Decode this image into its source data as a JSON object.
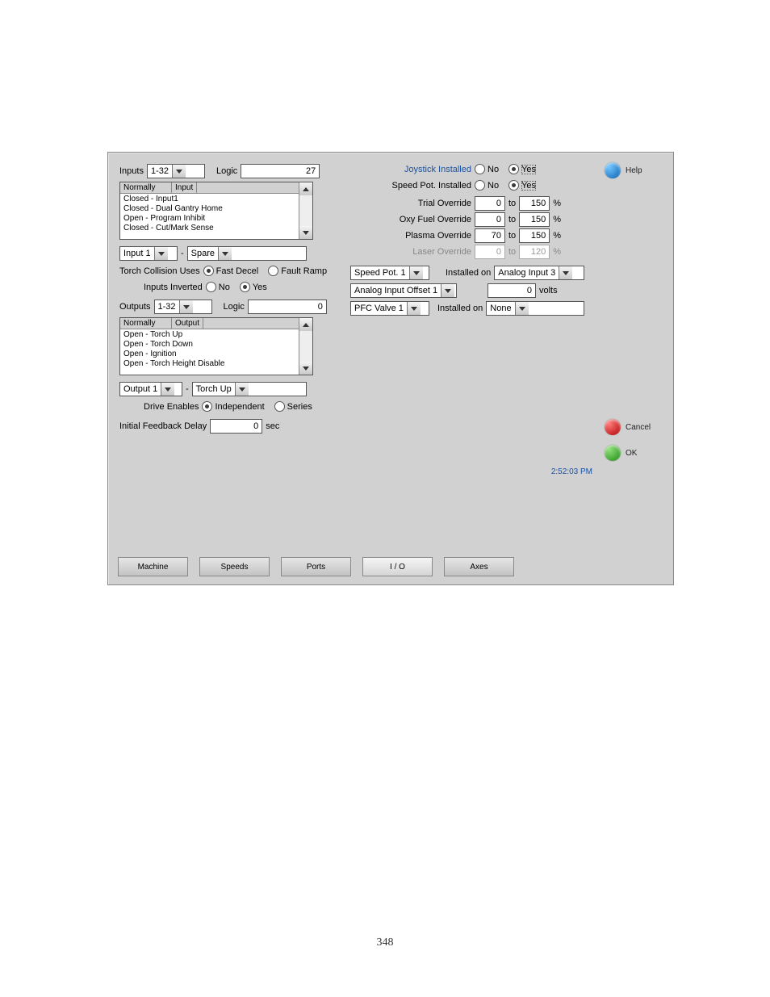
{
  "page_number": "348",
  "time": "2:52:03 PM",
  "inputs": {
    "label": "Inputs",
    "range": "1-32",
    "logic_label": "Logic",
    "logic_value": "27",
    "list_header": {
      "col1": "Normally",
      "col2": "Input"
    },
    "rows": [
      "Closed  -  Input1",
      "Closed  -  Dual Gantry Home",
      "Open    -  Program Inhibit",
      "Closed  -  Cut/Mark Sense"
    ],
    "assign_left": "Input 1",
    "assign_right": "Spare"
  },
  "torch_collision": {
    "label": "Torch Collision Uses",
    "opt1": "Fast Decel",
    "opt2": "Fault Ramp",
    "selected": "opt1"
  },
  "inputs_inverted": {
    "label": "Inputs Inverted",
    "no": "No",
    "yes": "Yes",
    "selected": "yes"
  },
  "outputs": {
    "label": "Outputs",
    "range": "1-32",
    "logic_label": "Logic",
    "logic_value": "0",
    "list_header": {
      "col1": "Normally",
      "col2": "Output"
    },
    "rows": [
      "Open    -  Torch Up",
      "Open    -  Torch Down",
      "Open    -  Ignition",
      "Open    -  Torch Height Disable"
    ],
    "assign_left": "Output 1",
    "assign_right": "Torch Up"
  },
  "drive_enables": {
    "label": "Drive Enables",
    "opt1": "Independent",
    "opt2": "Series",
    "selected": "opt1"
  },
  "feedback_delay": {
    "label": "Initial Feedback Delay",
    "value": "0",
    "unit": "sec"
  },
  "joystick": {
    "label": "Joystick Installed",
    "no": "No",
    "yes": "Yes",
    "selected": "yes"
  },
  "speedpot": {
    "label": "Speed Pot. Installed",
    "no": "No",
    "yes": "Yes",
    "selected": "yes"
  },
  "overrides": {
    "to": "to",
    "pct": "%",
    "trial": {
      "label": "Trial Override",
      "lo": "0",
      "hi": "150",
      "enabled": true
    },
    "oxy": {
      "label": "Oxy Fuel Override",
      "lo": "0",
      "hi": "150",
      "enabled": true
    },
    "plasma": {
      "label": "Plasma Override",
      "lo": "70",
      "hi": "150",
      "enabled": true
    },
    "laser": {
      "label": "Laser Override",
      "lo": "0",
      "hi": "120",
      "enabled": false
    }
  },
  "speed_pot_assign": {
    "left": "Speed Pot. 1",
    "installed_on": "Installed on",
    "right": "Analog Input 3"
  },
  "analog_offset": {
    "left": "Analog Input Offset 1",
    "value": "0",
    "unit": "volts"
  },
  "pfc": {
    "left": "PFC Valve 1",
    "installed_on": "Installed on",
    "right": "None"
  },
  "buttons": {
    "help": "Help",
    "cancel": "Cancel",
    "ok": "OK"
  },
  "tabs": [
    "Machine",
    "Speeds",
    "Ports",
    "I / O",
    "Axes"
  ],
  "active_tab": 3
}
